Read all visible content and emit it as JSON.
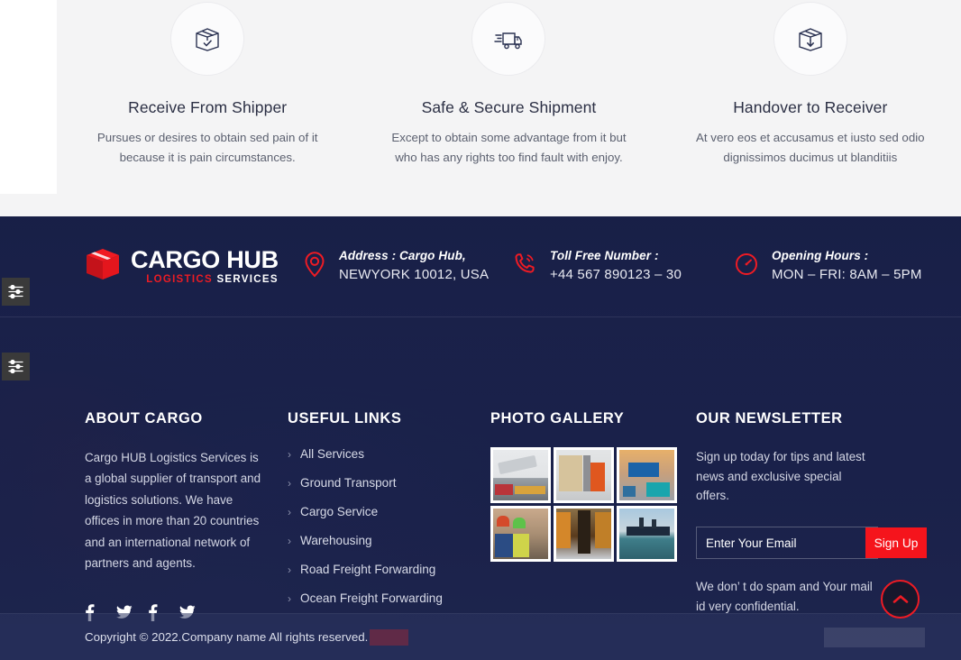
{
  "features": [
    {
      "icon": "box-check-icon",
      "title": "Receive From Shipper",
      "desc": "Pursues or desires to obtain sed pain of it because it is pain circumstances."
    },
    {
      "icon": "delivery-truck-icon",
      "title": "Safe & Secure Shipment",
      "desc": "Except to obtain some advantage from it but who has any rights too find fault with enjoy."
    },
    {
      "icon": "box-download-icon",
      "title": "Handover to Receiver",
      "desc": "At vero eos et accusamus et iusto sed odio dignissimos ducimus ut blanditiis"
    }
  ],
  "contact_bar": {
    "logo": {
      "icon": "cargo-box-logo-icon",
      "main": "CARGO HUB",
      "sub_red": "LOGISTICS",
      "sub_white": "SERVICES"
    },
    "items": [
      {
        "icon": "map-pin-icon",
        "label": "Address : Cargo Hub,",
        "value": "NEWYORK 10012, USA"
      },
      {
        "icon": "phone-ring-icon",
        "label": "Toll Free Number :",
        "value": "+44 567 890123 – 30"
      },
      {
        "icon": "clock-icon",
        "label": "Opening Hours :",
        "value": "MON – FRI: 8AM – 5PM"
      }
    ]
  },
  "footer": {
    "about": {
      "heading": "ABOUT CARGO",
      "text": "Cargo HUB Logistics Services is a global supplier of transport and logistics solutions. We have offices in more than 20 countries and an international network of partners and agents.",
      "social": [
        {
          "name": "facebook-icon",
          "glyph": "f"
        },
        {
          "name": "twitter-icon",
          "glyph": "t"
        },
        {
          "name": "facebook-icon",
          "glyph": "f"
        },
        {
          "name": "twitter-icon",
          "glyph": "t"
        }
      ]
    },
    "links": {
      "heading": "USEFUL LINKS",
      "items": [
        "All Services",
        "Ground Transport",
        "Cargo Service",
        "Warehousing",
        "Road Freight Forwarding",
        "Ocean Freight Forwarding"
      ]
    },
    "gallery": {
      "heading": "PHOTO GALLERY",
      "items": [
        {
          "name": "gallery-air-freight",
          "c1": "#e8eaec",
          "c2": "#b9343a",
          "c3": "#6d7176"
        },
        {
          "name": "gallery-forklift-boxes",
          "c1": "#d6c39c",
          "c2": "#e0571f",
          "c3": "#8d8f94"
        },
        {
          "name": "gallery-container-terminal",
          "c1": "#e7b06a",
          "c2": "#1b63a8",
          "c3": "#1aa5ad"
        },
        {
          "name": "gallery-warehouse-workers",
          "c1": "#d44a2a",
          "c2": "#5ec24a",
          "c3": "#2b4c84"
        },
        {
          "name": "gallery-warehouse-aisle",
          "c1": "#5a3b1d",
          "c2": "#d4872a",
          "c3": "#2a2016"
        },
        {
          "name": "gallery-cargo-ship-sunset",
          "c1": "#a9c8df",
          "c2": "#1d2a3c",
          "c3": "#3f7e8a"
        }
      ]
    },
    "newsletter": {
      "heading": "OUR NEWSLETTER",
      "text": "Sign up today for tips and latest news and exclusive special offers.",
      "placeholder": "Enter Your Email",
      "value": "",
      "button": "Sign Up",
      "note": "We don’ t do spam and Your mail id very confidential."
    }
  },
  "copyright": {
    "text": "Copyright © 2022.Company name All rights reserved."
  },
  "widgets": {
    "settings_top": "settings-sliders-icon",
    "settings_bottom": "settings-sliders-icon",
    "scroll_top": "chevron-up-icon"
  },
  "colors": {
    "accent_red": "#ee1b24",
    "footer_navy": "#1b2350",
    "features_bg": "#f4f4f5"
  }
}
